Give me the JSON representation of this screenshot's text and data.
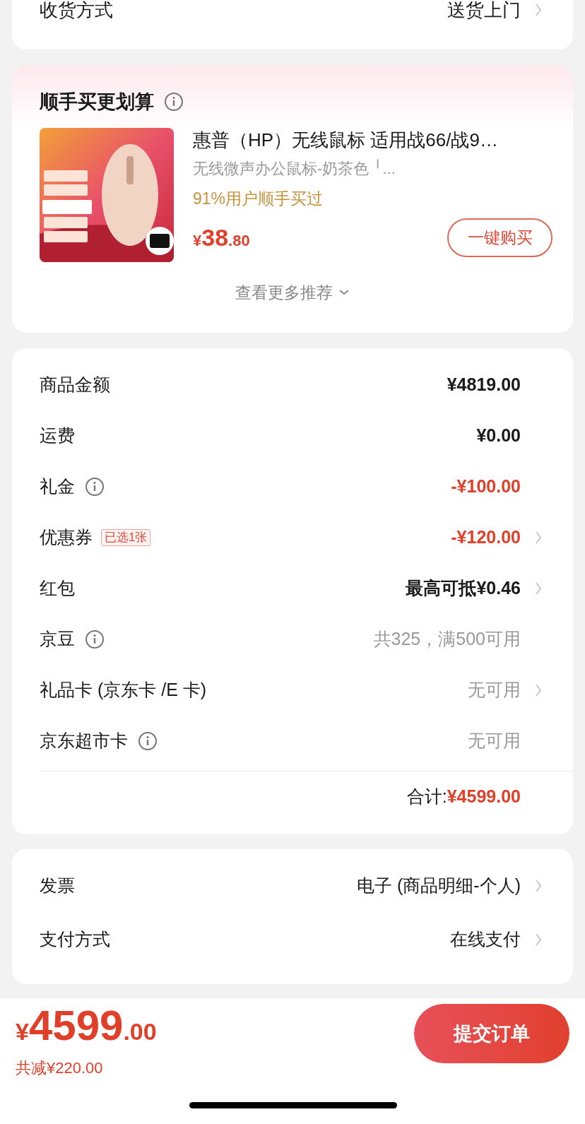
{
  "delivery": {
    "label": "收货方式",
    "value": "送货上门"
  },
  "bundle": {
    "title": "顺手买更划算",
    "product": {
      "kind": "picture",
      "name": "惠普（HP）无线鼠标 适用战66/战9…",
      "spec": "无线微声办公鼠标-奶茶色 ╵...",
      "note": "91%用户顺手买过",
      "currency": "¥",
      "price_int": "38",
      "price_dec": ".80",
      "button": "一键购买"
    },
    "more": "查看更多推荐"
  },
  "fees": [
    {
      "label": "商品金额",
      "info": false,
      "value": "¥4819.00",
      "kind": "amount",
      "arrow": false
    },
    {
      "label": "运费",
      "info": false,
      "value": "¥0.00",
      "kind": "amount",
      "arrow": false
    },
    {
      "label": "礼金",
      "info": true,
      "value": "-¥100.00",
      "kind": "discount",
      "arrow": false
    },
    {
      "label": "优惠券",
      "info": false,
      "badge": "已选1张",
      "value": "-¥120.00",
      "kind": "discount",
      "arrow": true
    },
    {
      "label": "红包",
      "info": false,
      "value": "最高可抵¥0.46",
      "kind": "amount",
      "arrow": true
    },
    {
      "label": "京豆",
      "info": true,
      "value": "共325，满500可用",
      "kind": "hint",
      "arrow": false
    },
    {
      "label": "礼品卡 (京东卡 /E 卡)",
      "info": false,
      "value": "无可用",
      "kind": "hint",
      "arrow": true
    },
    {
      "label": "京东超市卡",
      "info": true,
      "value": "无可用",
      "kind": "hint",
      "arrow": false
    }
  ],
  "total": {
    "label": "合计:",
    "value": "¥4599.00"
  },
  "options": [
    {
      "label": "发票",
      "value": "电子 (商品明细-个人)"
    },
    {
      "label": "支付方式",
      "value": "在线支付"
    }
  ],
  "footer": {
    "currency": "¥",
    "price_int": "4599",
    "price_dec": ".00",
    "saved": "共减¥220.00",
    "submit": "提交订单"
  }
}
